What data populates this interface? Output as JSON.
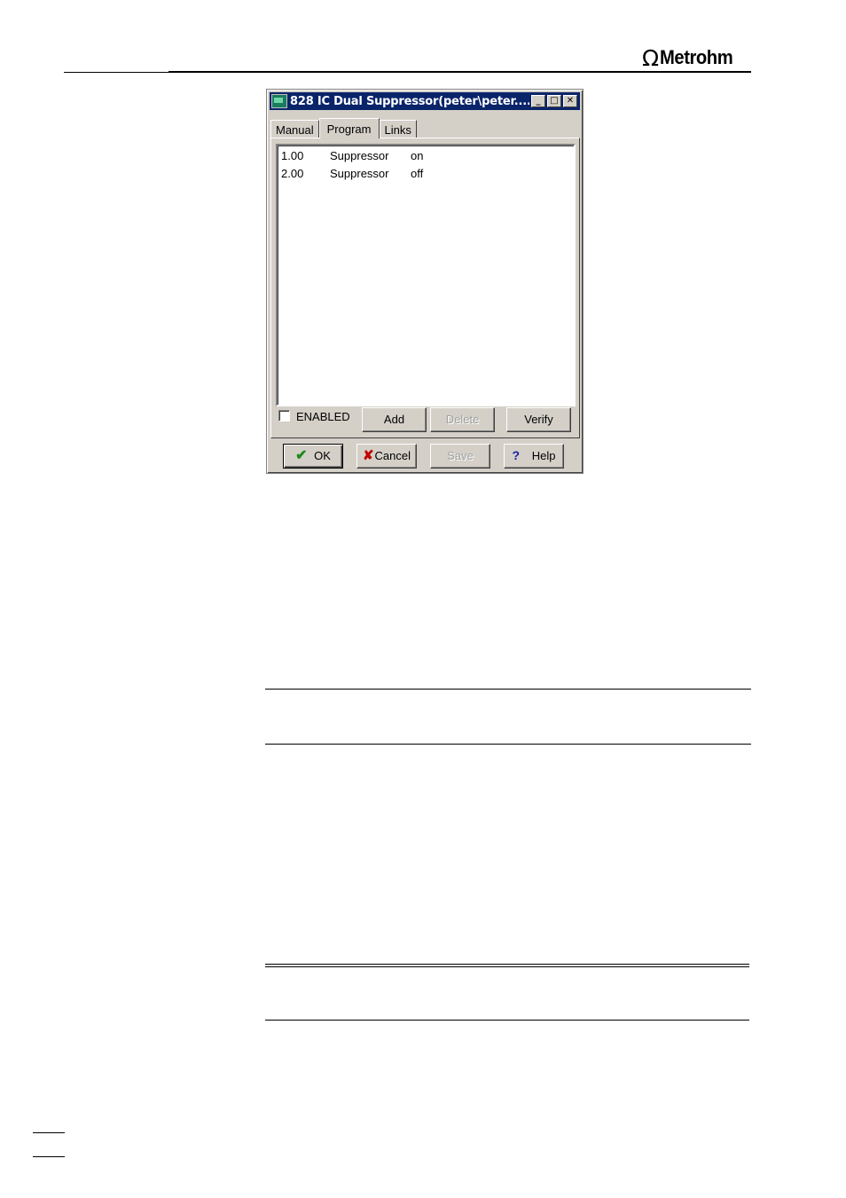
{
  "logo": {
    "symbol": "Ω",
    "text": "Metrohm"
  },
  "window": {
    "title": "828 IC Dual Suppressor(peter\\peter....",
    "title_buttons": {
      "minimize": "_",
      "maximize": "□",
      "close": "✕"
    },
    "tabs": [
      {
        "label": "Manual",
        "active": false
      },
      {
        "label": "Program",
        "active": true
      },
      {
        "label": "Links",
        "active": false
      }
    ],
    "program_rows": [
      {
        "time": "1.00",
        "device": "Suppressor",
        "state": "on"
      },
      {
        "time": "2.00",
        "device": "Suppressor",
        "state": "off"
      }
    ],
    "enabled_label": "ENABLED",
    "enabled_checked": false,
    "buttons": {
      "add": "Add",
      "delete": "Delete",
      "verify": "Verify",
      "ok": "OK",
      "cancel": "Cancel",
      "save": "Save",
      "help": "Help"
    },
    "icons": {
      "ok": "check-icon",
      "cancel": "x-icon",
      "help": "question-icon"
    }
  }
}
